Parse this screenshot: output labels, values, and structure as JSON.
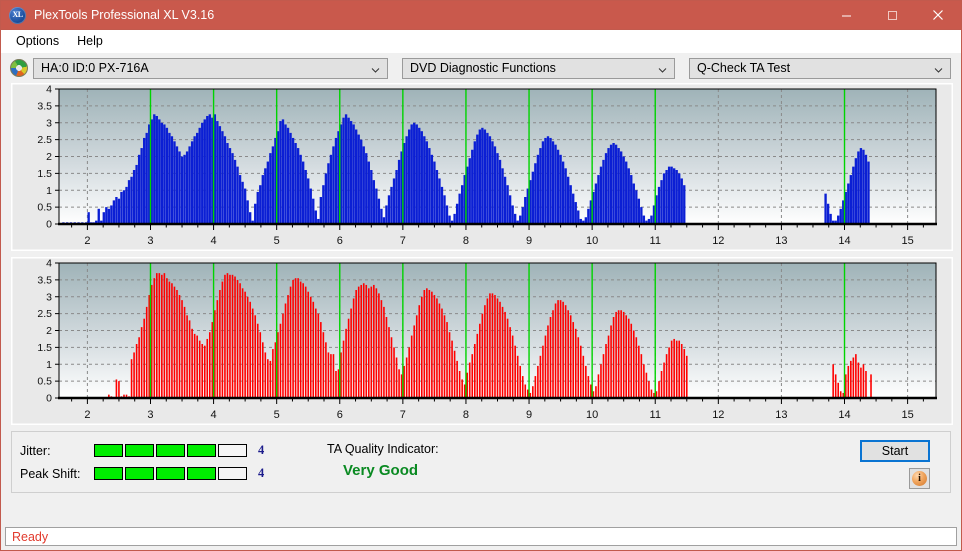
{
  "window": {
    "title": "PlexTools Professional XL V3.16",
    "icon": "xl-disc-icon",
    "icon_text": "XL",
    "accent_color": "#c9594c",
    "controls": {
      "minimize": "minimize-icon",
      "maximize": "maximize-icon",
      "close": "close-icon"
    }
  },
  "menu": {
    "items": [
      {
        "label": "Options"
      },
      {
        "label": "Help"
      }
    ]
  },
  "toolbar": {
    "drive_icon": "disc-icon",
    "drive_select": {
      "value": "HA:0 ID:0  PX-716A",
      "options": [
        "HA:0 ID:0  PX-716A"
      ]
    },
    "function_select": {
      "value": "DVD Diagnostic Functions",
      "options": [
        "DVD Diagnostic Functions"
      ]
    },
    "test_select": {
      "value": "Q-Check TA Test",
      "options": [
        "Q-Check TA Test"
      ]
    }
  },
  "results": {
    "jitter_label": "Jitter:",
    "jitter_value": "4",
    "jitter_filled": 4,
    "jitter_total": 5,
    "peak_shift_label": "Peak Shift:",
    "peak_shift_value": "4",
    "peak_shift_filled": 4,
    "peak_shift_total": 5,
    "ta_quality_label": "TA Quality Indicator:",
    "ta_quality_value": "Very Good",
    "ta_quality_color": "#0a8a22",
    "meter_on_color": "#00ed00",
    "start_button": "Start",
    "info_button": "i"
  },
  "statusbar": {
    "text": "Ready",
    "color": "#e23b2e"
  },
  "chart_data": [
    {
      "id": "jitter-chart",
      "type": "bar",
      "title": "",
      "series_name": "Jitter",
      "color": "#0b1fd4",
      "xlabel": "",
      "ylabel": "",
      "ylim": [
        0,
        4
      ],
      "yticks": [
        0,
        0.5,
        1,
        1.5,
        2,
        2.5,
        3,
        3.5,
        4
      ],
      "ytick_labels": [
        "0",
        "0.5",
        "1",
        "1.5",
        "2",
        "2.5",
        "3",
        "3.5",
        "4"
      ],
      "xlim": [
        1.55,
        15.45
      ],
      "xticks": [
        2,
        3,
        4,
        5,
        6,
        7,
        8,
        9,
        10,
        11,
        12,
        13,
        14,
        15
      ],
      "xtick_labels": [
        "2",
        "3",
        "4",
        "5",
        "6",
        "7",
        "8",
        "9",
        "10",
        "11",
        "12",
        "13",
        "14",
        "15"
      ],
      "grid": true,
      "markers": [
        3,
        4,
        5,
        6,
        7,
        8,
        9,
        10,
        11,
        14
      ],
      "marker_color": "#00d400",
      "bar_x": [
        1.62,
        1.68,
        1.74,
        1.8,
        1.86,
        1.92,
        1.98,
        2.02,
        2.06,
        2.1,
        2.14,
        2.18,
        2.22,
        2.26,
        2.3,
        2.34,
        2.38,
        2.42,
        2.46,
        2.5,
        2.54,
        2.58,
        2.62,
        2.66,
        2.7,
        2.74,
        2.78,
        2.82,
        2.86,
        2.9,
        2.94,
        2.98,
        3.02,
        3.06,
        3.1,
        3.14,
        3.18,
        3.22,
        3.26,
        3.3,
        3.34,
        3.38,
        3.42,
        3.46,
        3.5,
        3.54,
        3.58,
        3.62,
        3.66,
        3.7,
        3.74,
        3.78,
        3.82,
        3.86,
        3.9,
        3.94,
        3.98,
        4.02,
        4.06,
        4.1,
        4.14,
        4.18,
        4.22,
        4.26,
        4.3,
        4.34,
        4.38,
        4.42,
        4.46,
        4.5,
        4.54,
        4.58,
        4.62,
        4.66,
        4.7,
        4.74,
        4.78,
        4.82,
        4.86,
        4.9,
        4.94,
        4.98,
        5.02,
        5.06,
        5.1,
        5.14,
        5.18,
        5.22,
        5.26,
        5.3,
        5.34,
        5.38,
        5.42,
        5.46,
        5.5,
        5.54,
        5.58,
        5.62,
        5.66,
        5.7,
        5.74,
        5.78,
        5.82,
        5.86,
        5.9,
        5.94,
        5.98,
        6.02,
        6.06,
        6.1,
        6.14,
        6.18,
        6.22,
        6.26,
        6.3,
        6.34,
        6.38,
        6.42,
        6.46,
        6.5,
        6.54,
        6.58,
        6.62,
        6.66,
        6.7,
        6.74,
        6.78,
        6.82,
        6.86,
        6.9,
        6.94,
        6.98,
        7.02,
        7.06,
        7.1,
        7.14,
        7.18,
        7.22,
        7.26,
        7.3,
        7.34,
        7.38,
        7.42,
        7.46,
        7.5,
        7.54,
        7.58,
        7.62,
        7.66,
        7.7,
        7.74,
        7.78,
        7.82,
        7.86,
        7.9,
        7.94,
        7.98,
        8.02,
        8.06,
        8.1,
        8.14,
        8.18,
        8.22,
        8.26,
        8.3,
        8.34,
        8.38,
        8.42,
        8.46,
        8.5,
        8.54,
        8.58,
        8.62,
        8.66,
        8.7,
        8.74,
        8.78,
        8.82,
        8.86,
        8.9,
        8.94,
        8.98,
        9.02,
        9.06,
        9.1,
        9.14,
        9.18,
        9.22,
        9.26,
        9.3,
        9.34,
        9.38,
        9.42,
        9.46,
        9.5,
        9.54,
        9.58,
        9.62,
        9.66,
        9.7,
        9.74,
        9.78,
        9.82,
        9.86,
        9.9,
        9.94,
        9.98,
        10.02,
        10.06,
        10.1,
        10.14,
        10.18,
        10.22,
        10.26,
        10.3,
        10.34,
        10.38,
        10.42,
        10.46,
        10.5,
        10.54,
        10.58,
        10.62,
        10.66,
        10.7,
        10.74,
        10.78,
        10.82,
        10.86,
        10.9,
        10.94,
        10.98,
        11.02,
        11.06,
        11.1,
        11.14,
        11.18,
        11.22,
        11.26,
        11.3,
        11.34,
        11.38,
        11.42,
        11.46,
        13.7,
        13.74,
        13.78,
        13.82,
        13.86,
        13.9,
        13.94,
        13.98,
        14.02,
        14.06,
        14.1,
        14.14,
        14.18,
        14.22,
        14.26,
        14.3,
        14.34,
        14.38
      ],
      "bar_y": [
        0.05,
        0.05,
        0.05,
        0.05,
        0.05,
        0.05,
        0.05,
        0.35,
        0.05,
        0.05,
        0.1,
        0.45,
        0.1,
        0.35,
        0.5,
        0.45,
        0.55,
        0.7,
        0.8,
        0.75,
        0.95,
        1.0,
        1.1,
        1.3,
        1.4,
        1.6,
        1.75,
        2.05,
        2.25,
        2.55,
        2.7,
        2.95,
        3.1,
        3.25,
        3.2,
        3.1,
        3.0,
        2.95,
        2.85,
        2.7,
        2.6,
        2.45,
        2.3,
        2.15,
        2.0,
        2.05,
        2.15,
        2.3,
        2.45,
        2.6,
        2.7,
        2.85,
        3.0,
        3.1,
        3.2,
        3.25,
        3.15,
        3.25,
        3.05,
        2.9,
        2.75,
        2.6,
        2.4,
        2.25,
        2.1,
        1.9,
        1.7,
        1.45,
        1.25,
        1.05,
        0.7,
        0.35,
        0.1,
        0.6,
        0.95,
        1.15,
        1.45,
        1.65,
        1.85,
        2.1,
        2.3,
        2.55,
        2.75,
        3.05,
        3.1,
        2.95,
        2.85,
        2.7,
        2.55,
        2.4,
        2.25,
        2.05,
        1.85,
        1.6,
        1.35,
        1.05,
        0.75,
        0.4,
        0.15,
        0.8,
        1.15,
        1.5,
        1.8,
        2.05,
        2.3,
        2.55,
        2.75,
        2.95,
        3.15,
        3.25,
        3.15,
        3.05,
        2.95,
        2.8,
        2.65,
        2.5,
        2.3,
        2.1,
        1.85,
        1.6,
        1.3,
        1.05,
        0.75,
        0.45,
        0.2,
        0.55,
        0.85,
        1.1,
        1.35,
        1.6,
        1.9,
        2.15,
        2.4,
        2.6,
        2.8,
        2.95,
        3.0,
        2.95,
        2.85,
        2.75,
        2.6,
        2.45,
        2.25,
        2.05,
        1.85,
        1.6,
        1.35,
        1.1,
        0.85,
        0.55,
        0.25,
        0.1,
        0.3,
        0.6,
        0.9,
        1.15,
        1.45,
        1.7,
        1.95,
        2.2,
        2.45,
        2.65,
        2.8,
        2.85,
        2.8,
        2.7,
        2.6,
        2.45,
        2.3,
        2.1,
        1.9,
        1.65,
        1.4,
        1.15,
        0.85,
        0.55,
        0.3,
        0.1,
        0.25,
        0.5,
        0.8,
        1.05,
        1.3,
        1.55,
        1.8,
        2.05,
        2.25,
        2.45,
        2.55,
        2.6,
        2.55,
        2.45,
        2.35,
        2.2,
        2.05,
        1.85,
        1.65,
        1.4,
        1.15,
        0.9,
        0.65,
        0.4,
        0.15,
        0.1,
        0.2,
        0.45,
        0.7,
        0.95,
        1.2,
        1.45,
        1.7,
        1.9,
        2.1,
        2.25,
        2.35,
        2.4,
        2.35,
        2.25,
        2.15,
        2.0,
        1.85,
        1.65,
        1.45,
        1.2,
        1.0,
        0.75,
        0.5,
        0.25,
        0.1,
        0.15,
        0.25,
        0.55,
        0.85,
        1.1,
        1.3,
        1.5,
        1.6,
        1.7,
        1.7,
        1.65,
        1.6,
        1.5,
        1.35,
        1.15,
        0.9,
        0.6,
        0.3,
        0.1,
        0.1,
        0.25,
        0.45,
        0.7,
        0.95,
        1.2,
        1.45,
        1.7,
        1.95,
        2.15,
        2.25,
        2.2,
        2.05,
        1.85,
        1.6,
        1.3,
        0.95,
        0.6,
        0.25,
        0.1
      ]
    },
    {
      "id": "peak-shift-chart",
      "type": "bar",
      "title": "",
      "series_name": "Peak Shift",
      "color": "#ff0000",
      "xlabel": "",
      "ylabel": "",
      "ylim": [
        0,
        4
      ],
      "yticks": [
        0,
        0.5,
        1,
        1.5,
        2,
        2.5,
        3,
        3.5,
        4
      ],
      "ytick_labels": [
        "0",
        "0.5",
        "1",
        "1.5",
        "2",
        "2.5",
        "3",
        "3.5",
        "4"
      ],
      "xlim": [
        1.55,
        15.45
      ],
      "xticks": [
        2,
        3,
        4,
        5,
        6,
        7,
        8,
        9,
        10,
        11,
        12,
        13,
        14,
        15
      ],
      "xtick_labels": [
        "2",
        "3",
        "4",
        "5",
        "6",
        "7",
        "8",
        "9",
        "10",
        "11",
        "12",
        "13",
        "14",
        "15"
      ],
      "grid": true,
      "markers": [
        3,
        4,
        5,
        6,
        7,
        8,
        9,
        10,
        11,
        14
      ],
      "marker_color": "#00d400",
      "bar_x": [
        2.34,
        2.38,
        2.46,
        2.5,
        2.54,
        2.58,
        2.62,
        2.66,
        2.7,
        2.74,
        2.78,
        2.82,
        2.86,
        2.9,
        2.94,
        2.98,
        3.02,
        3.06,
        3.1,
        3.14,
        3.18,
        3.22,
        3.26,
        3.3,
        3.34,
        3.38,
        3.42,
        3.46,
        3.5,
        3.54,
        3.58,
        3.62,
        3.66,
        3.7,
        3.74,
        3.78,
        3.82,
        3.86,
        3.9,
        3.94,
        3.98,
        4.02,
        4.06,
        4.1,
        4.14,
        4.18,
        4.22,
        4.26,
        4.3,
        4.34,
        4.38,
        4.42,
        4.46,
        4.5,
        4.54,
        4.58,
        4.62,
        4.66,
        4.7,
        4.74,
        4.78,
        4.82,
        4.86,
        4.9,
        4.94,
        4.98,
        5.02,
        5.06,
        5.1,
        5.14,
        5.18,
        5.22,
        5.26,
        5.3,
        5.34,
        5.38,
        5.42,
        5.46,
        5.5,
        5.54,
        5.58,
        5.62,
        5.66,
        5.7,
        5.74,
        5.78,
        5.82,
        5.86,
        5.9,
        5.94,
        5.98,
        6.02,
        6.06,
        6.1,
        6.14,
        6.18,
        6.22,
        6.26,
        6.3,
        6.34,
        6.38,
        6.42,
        6.46,
        6.5,
        6.54,
        6.58,
        6.62,
        6.66,
        6.7,
        6.74,
        6.78,
        6.82,
        6.86,
        6.9,
        6.94,
        6.98,
        7.02,
        7.06,
        7.1,
        7.14,
        7.18,
        7.22,
        7.26,
        7.3,
        7.34,
        7.38,
        7.42,
        7.46,
        7.5,
        7.54,
        7.58,
        7.62,
        7.66,
        7.7,
        7.74,
        7.78,
        7.82,
        7.86,
        7.9,
        7.94,
        7.98,
        8.02,
        8.06,
        8.1,
        8.14,
        8.18,
        8.22,
        8.26,
        8.3,
        8.34,
        8.38,
        8.42,
        8.46,
        8.5,
        8.54,
        8.58,
        8.62,
        8.66,
        8.7,
        8.74,
        8.78,
        8.82,
        8.86,
        8.9,
        8.94,
        8.98,
        9.02,
        9.06,
        9.1,
        9.14,
        9.18,
        9.22,
        9.26,
        9.3,
        9.34,
        9.38,
        9.42,
        9.46,
        9.5,
        9.54,
        9.58,
        9.62,
        9.66,
        9.7,
        9.74,
        9.78,
        9.82,
        9.86,
        9.9,
        9.94,
        9.98,
        10.02,
        10.06,
        10.1,
        10.14,
        10.18,
        10.22,
        10.26,
        10.3,
        10.34,
        10.38,
        10.42,
        10.46,
        10.5,
        10.54,
        10.58,
        10.62,
        10.66,
        10.7,
        10.74,
        10.78,
        10.82,
        10.86,
        10.9,
        10.94,
        10.98,
        11.02,
        11.06,
        11.1,
        11.14,
        11.18,
        11.22,
        11.26,
        11.3,
        11.34,
        11.38,
        11.42,
        11.46,
        11.5,
        13.82,
        13.86,
        13.9,
        13.94,
        13.98,
        14.02,
        14.06,
        14.1,
        14.14,
        14.18,
        14.22,
        14.26,
        14.3,
        14.34,
        14.42
      ],
      "bar_y": [
        0.1,
        0.05,
        0.55,
        0.5,
        0.05,
        0.1,
        0.1,
        0.05,
        1.15,
        1.35,
        1.6,
        1.8,
        2.1,
        2.35,
        2.7,
        3.05,
        3.35,
        3.55,
        3.7,
        3.7,
        3.65,
        3.7,
        3.55,
        3.45,
        3.4,
        3.3,
        3.2,
        3.05,
        2.9,
        2.7,
        2.45,
        2.3,
        2.05,
        1.9,
        1.85,
        1.7,
        1.6,
        1.55,
        1.75,
        1.95,
        2.25,
        2.6,
        2.9,
        3.2,
        3.45,
        3.65,
        3.7,
        3.65,
        3.65,
        3.6,
        3.5,
        3.4,
        3.25,
        3.15,
        3.0,
        2.85,
        2.65,
        2.45,
        2.2,
        1.95,
        1.65,
        1.35,
        1.15,
        1.1,
        1.45,
        1.65,
        1.95,
        2.2,
        2.5,
        2.8,
        3.05,
        3.3,
        3.5,
        3.55,
        3.55,
        3.45,
        3.4,
        3.3,
        3.15,
        3.0,
        2.85,
        2.65,
        2.5,
        2.25,
        1.95,
        1.65,
        1.35,
        1.3,
        1.3,
        0.8,
        0.85,
        1.35,
        1.7,
        2.05,
        2.35,
        2.65,
        2.95,
        3.2,
        3.3,
        3.35,
        3.4,
        3.35,
        3.25,
        3.3,
        3.35,
        3.25,
        3.1,
        2.9,
        2.7,
        2.4,
        2.1,
        1.8,
        1.5,
        1.2,
        0.85,
        0.7,
        0.95,
        1.2,
        1.5,
        1.85,
        2.15,
        2.45,
        2.75,
        3.0,
        3.2,
        3.25,
        3.2,
        3.15,
        3.05,
        2.95,
        2.8,
        2.65,
        2.45,
        2.25,
        1.95,
        1.7,
        1.4,
        1.1,
        0.8,
        0.55,
        0.4,
        0.75,
        1.05,
        1.3,
        1.6,
        1.9,
        2.2,
        2.5,
        2.75,
        2.95,
        3.1,
        3.1,
        3.05,
        2.95,
        2.85,
        2.7,
        2.55,
        2.35,
        2.1,
        1.85,
        1.55,
        1.25,
        0.95,
        0.65,
        0.4,
        0.25,
        0.15,
        0.35,
        0.65,
        0.95,
        1.25,
        1.55,
        1.85,
        2.15,
        2.4,
        2.6,
        2.8,
        2.9,
        2.9,
        2.85,
        2.75,
        2.6,
        2.45,
        2.25,
        2.05,
        1.8,
        1.55,
        1.25,
        0.95,
        0.65,
        0.4,
        0.2,
        0.35,
        0.7,
        1.0,
        1.3,
        1.6,
        1.85,
        2.15,
        2.4,
        2.55,
        2.6,
        2.6,
        2.55,
        2.45,
        2.35,
        2.2,
        2.0,
        1.8,
        1.55,
        1.3,
        1.0,
        0.75,
        0.5,
        0.25,
        0.15,
        0.2,
        0.5,
        0.8,
        1.05,
        1.3,
        1.5,
        1.7,
        1.75,
        1.7,
        1.7,
        1.6,
        1.45,
        1.25,
        1.0,
        0.7,
        0.45,
        0.2,
        0.15,
        0.7,
        0.95,
        1.1,
        1.2,
        1.3,
        1.05,
        0.9,
        1.0,
        0.8,
        0.7,
        0.55,
        0.45,
        0.3,
        0.15,
        0.1
      ]
    }
  ]
}
